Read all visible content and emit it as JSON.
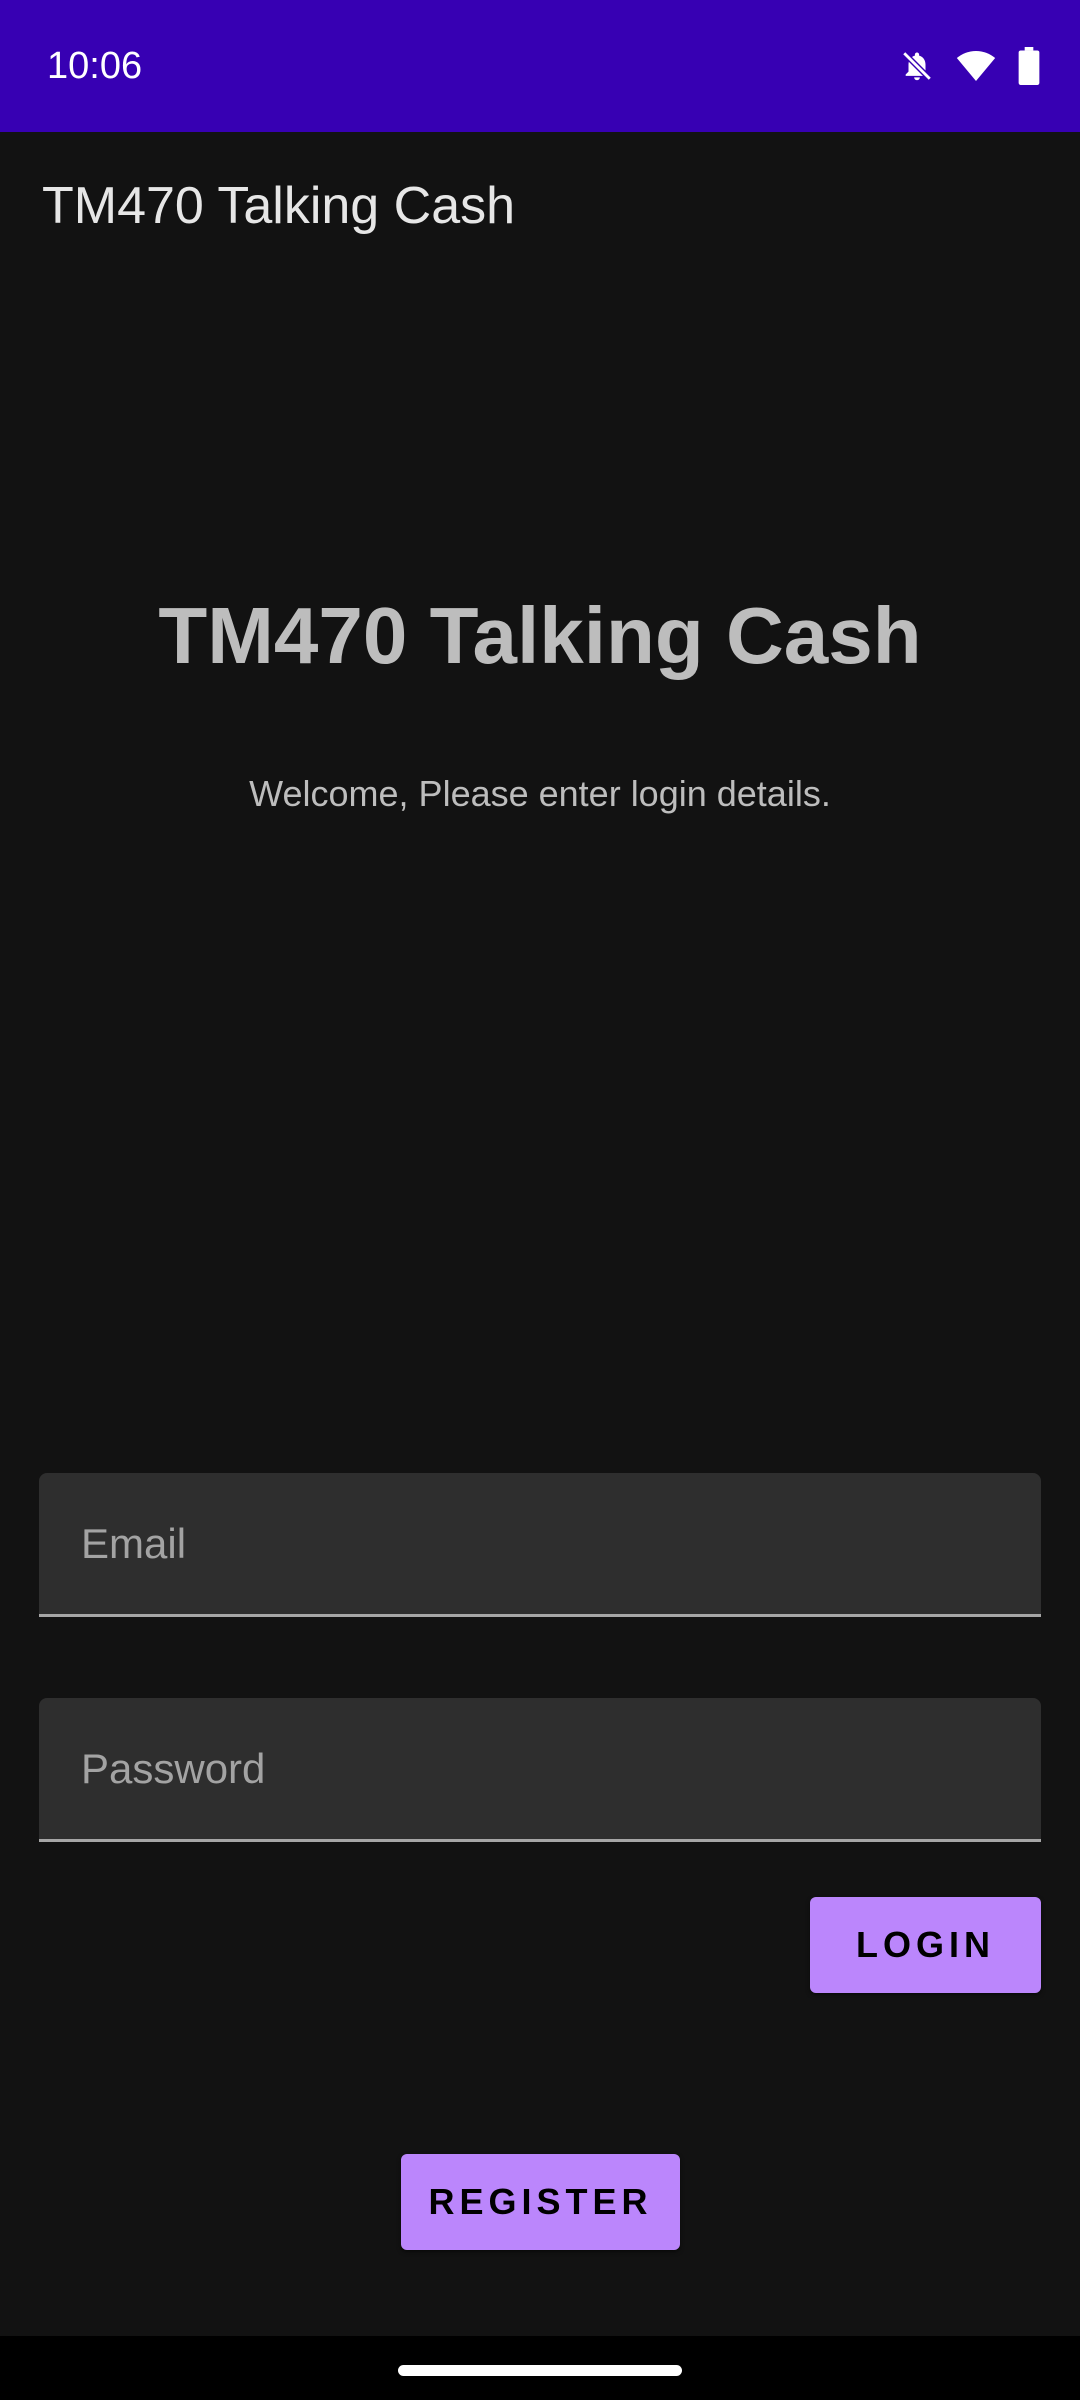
{
  "status_bar": {
    "time": "10:06",
    "icons": [
      "notifications-off-icon",
      "wifi-icon",
      "battery-icon"
    ],
    "background": "#3700B3"
  },
  "app_bar": {
    "title": "TM470 Talking Cash"
  },
  "hero": {
    "title": "TM470 Talking Cash",
    "subtitle": "Welcome, Please enter login details."
  },
  "form": {
    "email": {
      "placeholder": "Email",
      "value": ""
    },
    "password": {
      "placeholder": "Password",
      "value": ""
    },
    "login_label": "LOGIN",
    "register_label": "REGISTER"
  },
  "colors": {
    "background": "#121212",
    "accent": "#BB86FC",
    "field_background": "#2E2E2E"
  }
}
